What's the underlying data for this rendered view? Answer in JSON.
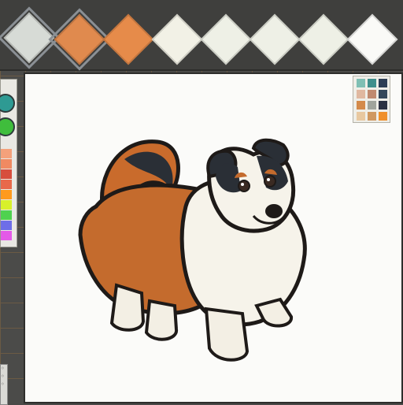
{
  "swatches": [
    {
      "color": "#d7dbd6",
      "selected": true
    },
    {
      "color": "#e08a4e",
      "selected": true
    },
    {
      "color": "#e68b4a",
      "selected": false
    },
    {
      "color": "#f2f1e6",
      "selected": false
    },
    {
      "color": "#eef0e6",
      "selected": false
    },
    {
      "color": "#eef0e6",
      "selected": false
    },
    {
      "color": "#eef0e6",
      "selected": false
    },
    {
      "color": "#fafaf7",
      "selected": false
    }
  ],
  "left_palette": [
    "#f4a17b",
    "#f08a62",
    "#d74e3d",
    "#e8694b",
    "#ff9a1e",
    "#d8f02a",
    "#4fd24f",
    "#6e6ee8",
    "#e45ae8"
  ],
  "mini_palette": [
    "#7fbfb4",
    "#3f8f8c",
    "#2d3e55",
    "#e0b8a0",
    "#c08a70",
    "#34475a",
    "#d48a4a",
    "#a0a49c",
    "#2b3142",
    "#e8c8a0",
    "#d09860",
    "#f0902a"
  ],
  "subject": "dog-illustration"
}
